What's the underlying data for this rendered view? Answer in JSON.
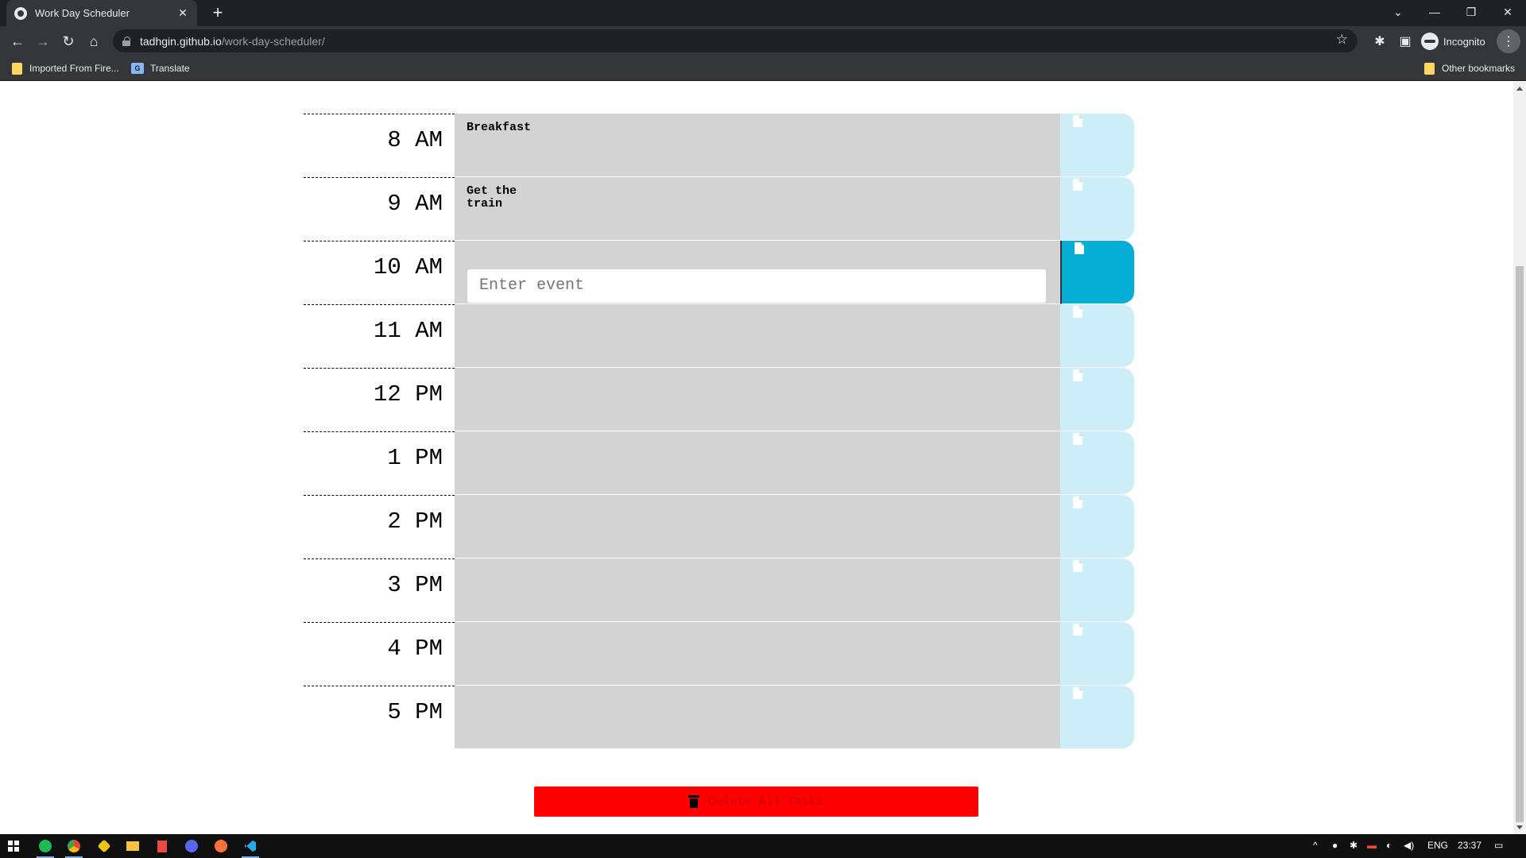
{
  "browser": {
    "tab_title": "Work Day Scheduler",
    "tab_close": "✕",
    "new_tab": "+",
    "url_host": "tadhgin.github.io",
    "url_path": "/work-day-scheduler/",
    "profile_label": "Incognito",
    "bookmarks": [
      "Imported From Fire...",
      "Translate"
    ],
    "other_bookmarks": "Other bookmarks"
  },
  "scheduler": {
    "rows": [
      {
        "hour": "8 AM",
        "text": "Breakfast"
      },
      {
        "hour": "9 AM",
        "text": "Get the\ntrain"
      },
      {
        "hour": "10 AM",
        "text": "",
        "placeholder": "Enter event"
      },
      {
        "hour": "11 AM",
        "text": ""
      },
      {
        "hour": "12 PM",
        "text": ""
      },
      {
        "hour": "1 PM",
        "text": ""
      },
      {
        "hour": "2 PM",
        "text": ""
      },
      {
        "hour": "3 PM",
        "text": ""
      },
      {
        "hour": "4 PM",
        "text": ""
      },
      {
        "hour": "5 PM",
        "text": ""
      }
    ],
    "delete_label": "Delete All Tasks"
  },
  "taskbar": {
    "language": "ENG",
    "time": "23:37"
  },
  "colors": {
    "row_bg": "#d3d3d3",
    "save_bg": "#cdeef8",
    "save_active_bg": "#06aed5",
    "delete_bg": "#ff0000"
  }
}
